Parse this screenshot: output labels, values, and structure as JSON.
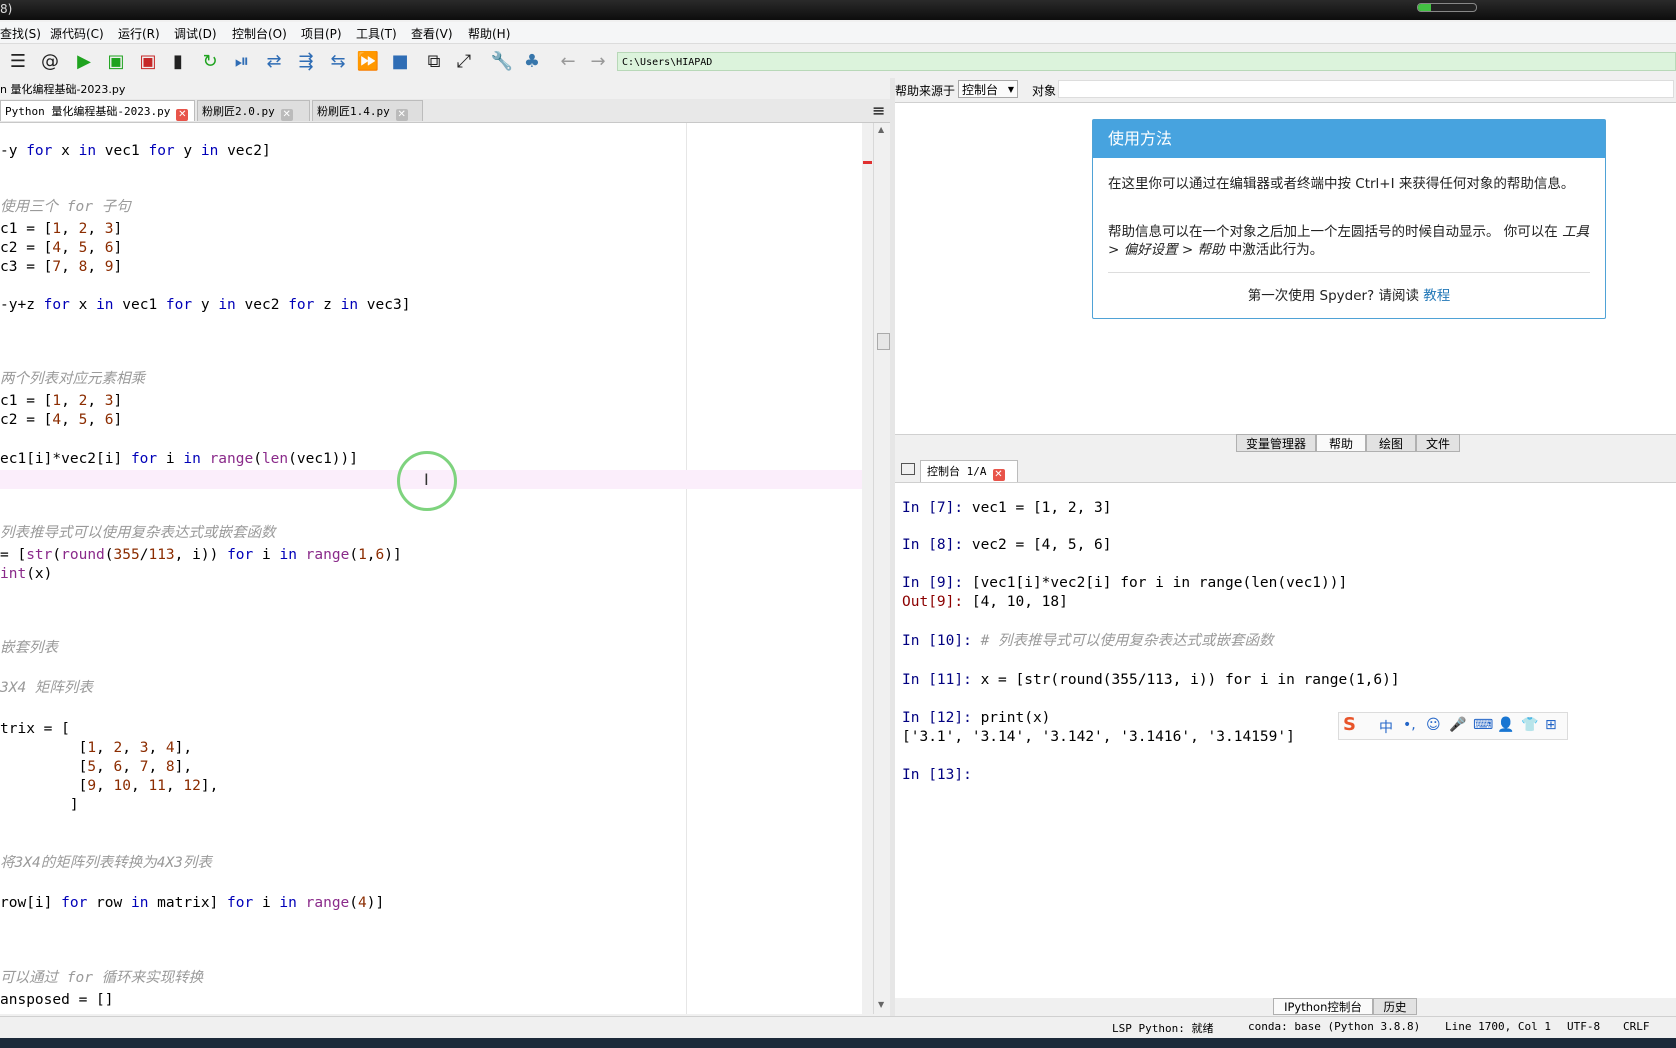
{
  "window": {
    "title_fragment": "8)",
    "progress": 0.22
  },
  "menu": [
    "查找(S)",
    "源代码(C)",
    "运行(R)",
    "调试(D)",
    "控制台(O)",
    "项目(P)",
    "工具(T)",
    "查看(V)",
    "帮助(H)"
  ],
  "toolbar": {
    "icons": [
      "outline-icon",
      "at-icon",
      "run-icon",
      "run-cell-icon",
      "run-cell-advance-icon",
      "run-selection-icon",
      "rerun-icon",
      "debug-icon",
      "step-icon",
      "step-into-icon",
      "step-return-icon",
      "continue-icon",
      "stop-icon",
      "maximize-pane-icon",
      "fullscreen-icon",
      "preferences-icon",
      "python-path-icon",
      "back-icon",
      "forward-icon"
    ],
    "path": "C:\\Users\\HIAPAD"
  },
  "editor": {
    "file_path": "n 量化编程基础-2023.py",
    "tabs": [
      {
        "label": "Python 量化编程基础-2023.py",
        "active": true
      },
      {
        "label": "粉刷匠2.0.py",
        "active": false
      },
      {
        "label": "粉刷匠1.4.py",
        "active": false
      }
    ],
    "lines": {
      "l1": "-y for x in vec1 for y in vec2]",
      "c1": "使用三个 for 子句",
      "l2": "c1 = [1, 2, 3]",
      "l3": "c2 = [4, 5, 6]",
      "l4": "c3 = [7, 8, 9]",
      "l5": "-y+z for x in vec1 for y in vec2 for z in vec3]",
      "c2": "两个列表对应元素相乘",
      "l6": "c1 = [1, 2, 3]",
      "l7": "c2 = [4, 5, 6]",
      "l8": "ec1[i]*vec2[i] for i in range(len(vec1))]",
      "c3": "列表推导式可以使用复杂表达式或嵌套函数",
      "l9": "= [str(round(355/113, i)) for i in range(1,6)]",
      "l10": "int(x)",
      "c4": "嵌套列表",
      "c5": "3X4 矩阵列表",
      "l11": "trix = [",
      "l12": "         [1, 2, 3, 4],",
      "l13": "         [5, 6, 7, 8],",
      "l14": "         [9, 10, 11, 12],",
      "l15": "        ]",
      "c6": "将3X4的矩阵列表转换为4X3列表",
      "l16": "row[i] for row in matrix] for i in range(4)]",
      "c7": "可以通过 for 循环来实现转换",
      "l17": "ansposed = []"
    }
  },
  "help": {
    "source_label": "帮助来源于",
    "source_value": "控制台",
    "object_label": "对象",
    "box_title": "使用方法",
    "para1": "在这里你可以通过在编辑器或者终端中按 Ctrl+I 来获得任何对象的帮助信息。",
    "para2_a": "帮助信息可以在一个对象之后加上一个左圆括号的时候自动显示。 你可以在 ",
    "para2_b": "工具 > 偏好设置 > 帮助",
    "para2_c": " 中激活此行为。",
    "footer_text": "第一次使用 Spyder? 请阅读 ",
    "footer_link": "教程"
  },
  "pane_tabs": [
    "变量管理器",
    "帮助",
    "绘图",
    "文件"
  ],
  "console": {
    "tab": "控制台 1/A",
    "entries": [
      {
        "prompt": "In [7]:",
        "code": " vec1 = [1, 2, 3]"
      },
      {
        "prompt": "In [8]:",
        "code": " vec2 = [4, 5, 6]"
      },
      {
        "prompt": "In [9]:",
        "code": " [vec1[i]*vec2[i] for i in range(len(vec1))]"
      },
      {
        "prompt": "Out[9]:",
        "code": " [4, 10, 18]"
      },
      {
        "prompt": "In [10]:",
        "code": " # 列表推导式可以使用复杂表达式或嵌套函数"
      },
      {
        "prompt": "In [11]:",
        "code": " x = [str(round(355/113, i)) for i in range(1,6)]"
      },
      {
        "prompt": "In [12]:",
        "code": " print(x)"
      },
      {
        "prompt": "",
        "code": "['3.1', '3.14', '3.142', '3.1416', '3.14159']"
      },
      {
        "prompt": "In [13]:",
        "code": ""
      }
    ],
    "bottom_tabs": [
      "IPython控制台",
      "历史"
    ]
  },
  "ime": {
    "mode": "中",
    "icons": [
      "sogou-logo-icon",
      "punct-icon",
      "emoji-icon",
      "mic-icon",
      "keyboard-icon",
      "user-icon",
      "skin-icon",
      "apps-icon"
    ]
  },
  "status": {
    "lsp": "LSP Python: 就绪",
    "conda": "conda: base (Python 3.8.8)",
    "position": "Line 1700, Col 1",
    "encoding": "UTF-8",
    "eol": "CRLF"
  },
  "colors": {
    "accent": "#47a3df",
    "keyword": "#0000b8",
    "builtin": "#8a2a8a",
    "number": "#8b2c00",
    "comment": "#9a9a9a",
    "run_green": "#1fa31f",
    "stop_blue": "#2f6db5",
    "close_red": "#e8544a"
  }
}
